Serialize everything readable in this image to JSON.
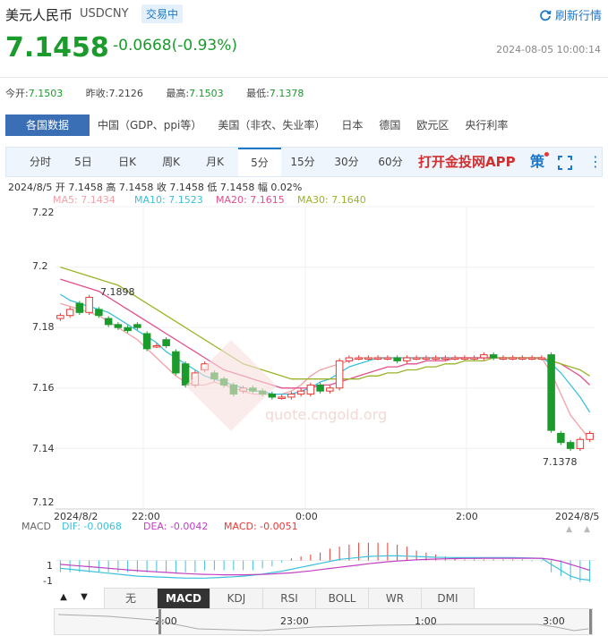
{
  "header": {
    "name": "美元人民币",
    "code": "USDCNY",
    "tag": "交易中",
    "refresh_label": "刷新行情",
    "price": "7.1458",
    "change": "-0.0668(-0.93%)",
    "timestamp": "2024-08-05 10:00:14"
  },
  "stats": [
    {
      "label": "今开:",
      "value": "7.1503"
    },
    {
      "label": "昨收:",
      "value": "7.2126"
    },
    {
      "label": "最高:",
      "value": "7.1503"
    },
    {
      "label": "最低:",
      "value": "7.1378"
    }
  ],
  "data_tabs": [
    "各国数据",
    "中国（GDP、ppi等）",
    "美国（非农、失业率）",
    "日本",
    "德国",
    "欧元区",
    "央行利率"
  ],
  "period_tabs": [
    "分时",
    "5日",
    "日K",
    "周K",
    "月K",
    "5分",
    "15分",
    "30分",
    "60分"
  ],
  "active_period": "5分",
  "app_link": "打开金投网APP",
  "strategy_label": "策",
  "ohlc_line": "2024/8/5  开 7.1458  高 7.1458  收 7.1458  低 7.1458  幅 0.02%",
  "ma": [
    {
      "label": "MA5: 7.1434",
      "color": "#f4a0a8"
    },
    {
      "label": "MA10: 7.1523",
      "color": "#3cc0dc"
    },
    {
      "label": "MA20: 7.1615",
      "color": "#e2508c"
    },
    {
      "label": "MA30: 7.1640",
      "color": "#9ab428"
    }
  ],
  "y_ticks": [
    "7.22",
    "7.2",
    "7.18",
    "7.16",
    "7.14",
    "7.12"
  ],
  "x_ticks": [
    "2024/8/2",
    "22:00",
    "0:00",
    "2:00",
    "2024/8/5"
  ],
  "annotations": {
    "high": "7.1898",
    "low": "7.1378"
  },
  "watermark": "quote.cngold.org",
  "macd": {
    "title": "MACD",
    "dif": "DIF: -0.0068",
    "dea": "DEA: -0.0042",
    "macd": "MACD: -0.0051",
    "y_ticks": [
      "1",
      "-1"
    ]
  },
  "indicator_tabs": [
    "无",
    "MACD",
    "KDJ",
    "RSI",
    "BOLL",
    "WR",
    "DMI"
  ],
  "active_indicator": "MACD",
  "navigator_labels": [
    "2:00",
    "23:00",
    "1:00",
    "3:00"
  ],
  "chart_data": {
    "type": "candlestick",
    "x_labels": [
      "2024/8/2",
      "22:00",
      "0:00",
      "2:00",
      "2024/8/5"
    ],
    "ylim": [
      7.12,
      7.22
    ],
    "candles": [
      {
        "o": 7.183,
        "c": 7.184
      },
      {
        "o": 7.184,
        "c": 7.186
      },
      {
        "o": 7.188,
        "c": 7.185
      },
      {
        "o": 7.185,
        "c": 7.19
      },
      {
        "o": 7.186,
        "c": 7.184
      },
      {
        "o": 7.183,
        "c": 7.181
      },
      {
        "o": 7.181,
        "c": 7.18
      },
      {
        "o": 7.18,
        "c": 7.179
      },
      {
        "o": 7.181,
        "c": 7.18
      },
      {
        "o": 7.178,
        "c": 7.173
      },
      {
        "o": 7.174,
        "c": 7.174
      },
      {
        "o": 7.176,
        "c": 7.174
      },
      {
        "o": 7.172,
        "c": 7.165
      },
      {
        "o": 7.168,
        "c": 7.161
      },
      {
        "o": 7.161,
        "c": 7.165
      },
      {
        "o": 7.166,
        "c": 7.168
      },
      {
        "o": 7.165,
        "c": 7.163
      },
      {
        "o": 7.163,
        "c": 7.161
      },
      {
        "o": 7.161,
        "c": 7.158
      },
      {
        "o": 7.159,
        "c": 7.16
      },
      {
        "o": 7.16,
        "c": 7.159
      },
      {
        "o": 7.159,
        "c": 7.158
      },
      {
        "o": 7.158,
        "c": 7.157
      },
      {
        "o": 7.157,
        "c": 7.157
      },
      {
        "o": 7.157,
        "c": 7.158
      },
      {
        "o": 7.158,
        "c": 7.159
      },
      {
        "o": 7.158,
        "c": 7.161
      },
      {
        "o": 7.161,
        "c": 7.159
      },
      {
        "o": 7.159,
        "c": 7.16
      },
      {
        "o": 7.16,
        "c": 7.169
      },
      {
        "o": 7.169,
        "c": 7.17
      },
      {
        "o": 7.17,
        "c": 7.17
      },
      {
        "o": 7.17,
        "c": 7.17
      },
      {
        "o": 7.17,
        "c": 7.17
      },
      {
        "o": 7.17,
        "c": 7.17
      },
      {
        "o": 7.17,
        "c": 7.169
      },
      {
        "o": 7.169,
        "c": 7.17
      },
      {
        "o": 7.17,
        "c": 7.17
      },
      {
        "o": 7.17,
        "c": 7.17
      },
      {
        "o": 7.17,
        "c": 7.17
      },
      {
        "o": 7.17,
        "c": 7.17
      },
      {
        "o": 7.17,
        "c": 7.17
      },
      {
        "o": 7.17,
        "c": 7.17
      },
      {
        "o": 7.17,
        "c": 7.17
      },
      {
        "o": 7.17,
        "c": 7.171
      },
      {
        "o": 7.171,
        "c": 7.17
      },
      {
        "o": 7.17,
        "c": 7.17
      },
      {
        "o": 7.17,
        "c": 7.17
      },
      {
        "o": 7.17,
        "c": 7.17
      },
      {
        "o": 7.17,
        "c": 7.17
      },
      {
        "o": 7.17,
        "c": 7.17
      },
      {
        "o": 7.171,
        "c": 7.146
      },
      {
        "o": 7.145,
        "c": 7.142
      },
      {
        "o": 7.142,
        "c": 7.14
      },
      {
        "o": 7.14,
        "c": 7.143
      },
      {
        "o": 7.143,
        "c": 7.145
      }
    ],
    "series": [
      {
        "name": "MA5",
        "values": [
          7.188,
          7.187,
          7.186,
          7.185,
          7.184,
          7.182,
          7.18,
          7.178,
          7.176,
          7.173,
          7.17,
          7.167,
          7.164,
          7.162,
          7.161,
          7.161,
          7.162,
          7.161,
          7.16,
          7.159,
          7.158,
          7.158,
          7.158,
          7.158,
          7.159,
          7.161,
          7.164,
          7.166,
          7.167,
          7.168,
          7.169,
          7.17,
          7.17,
          7.17,
          7.17,
          7.17,
          7.17,
          7.17,
          7.17,
          7.17,
          7.17,
          7.17,
          7.17,
          7.17,
          7.17,
          7.17,
          7.17,
          7.17,
          7.17,
          7.17,
          7.17,
          7.165,
          7.158,
          7.151,
          7.147,
          7.143
        ]
      },
      {
        "name": "MA10",
        "values": [
          7.191,
          7.189,
          7.188,
          7.187,
          7.186,
          7.185,
          7.183,
          7.181,
          7.179,
          7.177,
          7.175,
          7.172,
          7.17,
          7.168,
          7.166,
          7.164,
          7.163,
          7.162,
          7.161,
          7.16,
          7.159,
          7.159,
          7.158,
          7.158,
          7.158,
          7.159,
          7.16,
          7.162,
          7.163,
          7.165,
          7.167,
          7.168,
          7.169,
          7.17,
          7.17,
          7.17,
          7.17,
          7.17,
          7.17,
          7.17,
          7.17,
          7.17,
          7.17,
          7.17,
          7.17,
          7.17,
          7.17,
          7.17,
          7.17,
          7.17,
          7.17,
          7.168,
          7.165,
          7.161,
          7.157,
          7.152
        ]
      },
      {
        "name": "MA20",
        "values": [
          7.196,
          7.195,
          7.194,
          7.193,
          7.192,
          7.19,
          7.188,
          7.186,
          7.184,
          7.182,
          7.18,
          7.178,
          7.176,
          7.174,
          7.172,
          7.17,
          7.168,
          7.166,
          7.165,
          7.164,
          7.163,
          7.162,
          7.161,
          7.16,
          7.16,
          7.16,
          7.16,
          7.161,
          7.161,
          7.162,
          7.163,
          7.164,
          7.165,
          7.166,
          7.167,
          7.167,
          7.168,
          7.168,
          7.169,
          7.169,
          7.169,
          7.17,
          7.17,
          7.17,
          7.17,
          7.17,
          7.17,
          7.17,
          7.17,
          7.17,
          7.17,
          7.169,
          7.168,
          7.166,
          7.164,
          7.161
        ]
      },
      {
        "name": "MA30",
        "values": [
          7.2,
          7.199,
          7.198,
          7.197,
          7.196,
          7.195,
          7.194,
          7.192,
          7.19,
          7.188,
          7.186,
          7.184,
          7.182,
          7.18,
          7.178,
          7.176,
          7.174,
          7.172,
          7.17,
          7.168,
          7.167,
          7.166,
          7.165,
          7.164,
          7.163,
          7.163,
          7.163,
          7.163,
          7.163,
          7.163,
          7.163,
          7.163,
          7.164,
          7.164,
          7.165,
          7.165,
          7.166,
          7.166,
          7.167,
          7.167,
          7.168,
          7.168,
          7.169,
          7.169,
          7.169,
          7.17,
          7.17,
          7.17,
          7.17,
          7.17,
          7.17,
          7.169,
          7.168,
          7.167,
          7.166,
          7.164
        ]
      }
    ],
    "macd_bars": [
      -0.6,
      -0.6,
      -0.6,
      -0.6,
      -0.6,
      -0.6,
      -0.6,
      -0.6,
      -0.6,
      -0.6,
      -0.6,
      -0.6,
      -0.6,
      -0.6,
      -0.6,
      -0.5,
      -0.5,
      -0.5,
      -0.5,
      -0.5,
      -0.5,
      -0.4,
      -0.3,
      -0.1,
      0.1,
      0.2,
      0.3,
      0.4,
      0.6,
      0.7,
      0.8,
      0.9,
      0.9,
      0.9,
      0.9,
      0.8,
      0.7,
      0.5,
      0.4,
      0.3,
      0.2,
      0.1,
      0.05,
      0.05,
      0.05,
      0.05,
      0.05,
      0.05,
      0.05,
      -0.05,
      -0.05,
      -0.6,
      -0.8,
      -1.0,
      -1.1,
      -1.1
    ],
    "dif": [
      -0.4,
      -0.45,
      -0.5,
      -0.55,
      -0.6,
      -0.65,
      -0.7,
      -0.75,
      -0.8,
      -0.82,
      -0.84,
      -0.86,
      -0.88,
      -0.9,
      -0.9,
      -0.9,
      -0.88,
      -0.86,
      -0.83,
      -0.8,
      -0.75,
      -0.7,
      -0.62,
      -0.55,
      -0.45,
      -0.35,
      -0.25,
      -0.15,
      -0.05,
      0.05,
      0.1,
      0.15,
      0.2,
      0.22,
      0.23,
      0.23,
      0.22,
      0.2,
      0.18,
      0.16,
      0.15,
      0.14,
      0.14,
      0.14,
      0.14,
      0.14,
      0.14,
      0.14,
      0.13,
      0.12,
      0.1,
      -0.2,
      -0.5,
      -0.8,
      -0.95,
      -1.0
    ],
    "dea": [
      -0.2,
      -0.24,
      -0.28,
      -0.32,
      -0.36,
      -0.4,
      -0.44,
      -0.48,
      -0.52,
      -0.55,
      -0.58,
      -0.61,
      -0.64,
      -0.67,
      -0.69,
      -0.71,
      -0.72,
      -0.73,
      -0.73,
      -0.73,
      -0.72,
      -0.71,
      -0.69,
      -0.66,
      -0.63,
      -0.58,
      -0.53,
      -0.47,
      -0.41,
      -0.35,
      -0.29,
      -0.23,
      -0.17,
      -0.12,
      -0.07,
      -0.03,
      0.0,
      0.03,
      0.05,
      0.07,
      0.08,
      0.09,
      0.1,
      0.1,
      0.11,
      0.11,
      0.11,
      0.11,
      0.11,
      0.11,
      0.11,
      0.05,
      -0.05,
      -0.2,
      -0.35,
      -0.5
    ]
  }
}
